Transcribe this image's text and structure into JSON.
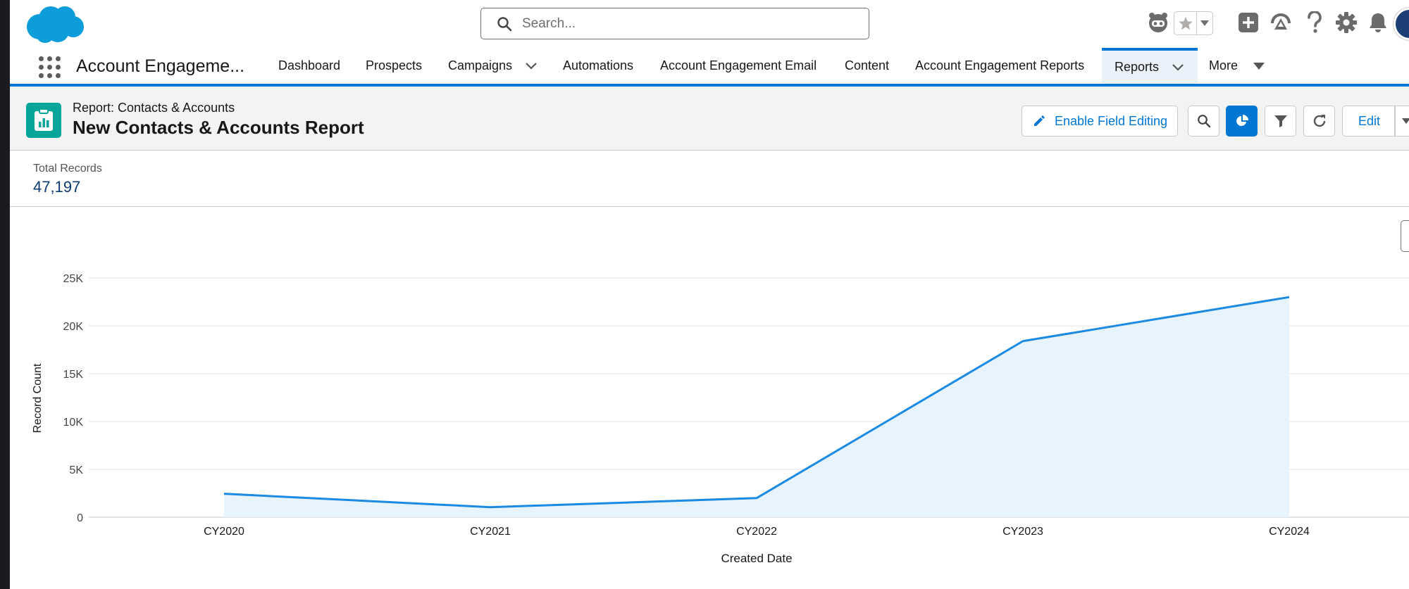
{
  "global_header": {
    "search_placeholder": "Search..."
  },
  "app_nav": {
    "app_name": "Account Engageme...",
    "items": [
      {
        "label": "Dashboard"
      },
      {
        "label": "Prospects"
      },
      {
        "label": "Campaigns"
      },
      {
        "label": "Automations"
      },
      {
        "label": "Account Engagement Email"
      },
      {
        "label": "Content"
      },
      {
        "label": "Account Engagement Reports"
      },
      {
        "label": "Reports"
      },
      {
        "label": "More"
      }
    ],
    "active": "Reports"
  },
  "report": {
    "type_label": "Report: Contacts & Accounts",
    "name": "New Contacts & Accounts Report",
    "enable_field_editing_label": "Enable Field Editing",
    "edit_label": "Edit"
  },
  "summary": {
    "label": "Total Records",
    "value": "47,197"
  },
  "colors": {
    "brand": "#0176d3",
    "line": "#1b8ae2",
    "area": "#e7f3fd"
  },
  "chart_data": {
    "type": "area",
    "categories": [
      "CY2020",
      "CY2021",
      "CY2022",
      "CY2023",
      "CY2024"
    ],
    "series": [
      {
        "values": [
          2450,
          1050,
          2000,
          18400,
          23000
        ]
      }
    ],
    "xlabel": "Created Date",
    "ylabel": "Record Count",
    "ylim": [
      0,
      25000
    ],
    "yticks": [
      {
        "value": 0,
        "label": "0"
      },
      {
        "value": 5000,
        "label": "5K"
      },
      {
        "value": 10000,
        "label": "10K"
      },
      {
        "value": 15000,
        "label": "15K"
      },
      {
        "value": 20000,
        "label": "20K"
      },
      {
        "value": 25000,
        "label": "25K"
      }
    ],
    "grid": true
  }
}
